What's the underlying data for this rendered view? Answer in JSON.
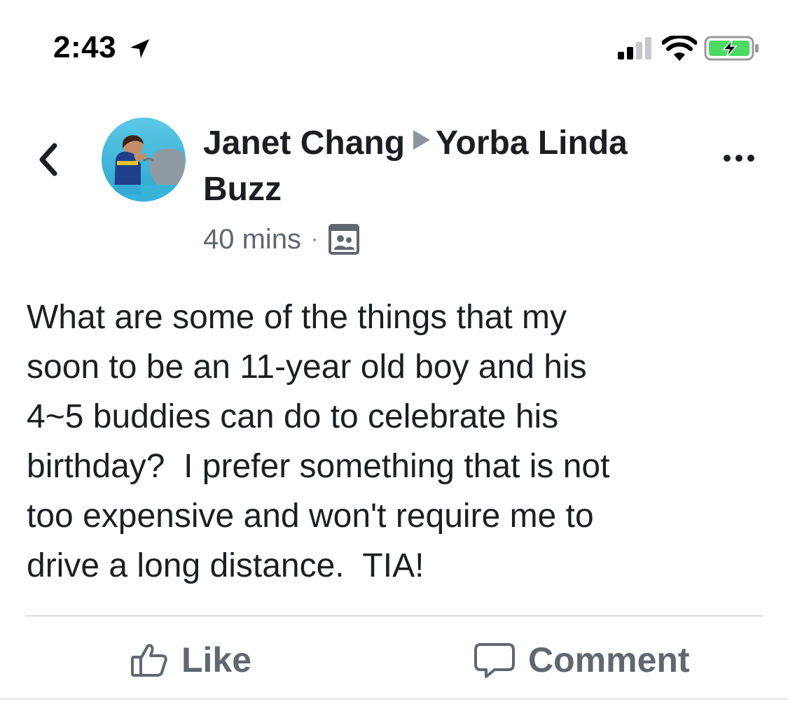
{
  "status_bar": {
    "time": "2:43",
    "location_icon": "location-arrow-icon",
    "signal_icon": "cellular-signal-icon",
    "wifi_icon": "wifi-icon",
    "battery_icon": "battery-charging-icon",
    "battery_color": "#4cd964"
  },
  "header": {
    "back_icon": "chevron-left-icon",
    "author": "Janet Chang",
    "group": "Yorba Linda Buzz",
    "more_icon": "ellipsis-icon",
    "time_ago": "40 mins",
    "separator": "·",
    "audience_icon": "group-members-icon"
  },
  "post": {
    "text": "What are some of the things that my\nsoon to be an 11-year old boy and his\n4~5 buddies can do to celebrate his\nbirthday?  I prefer something that is not\ntoo expensive and won't require me to\ndrive a long distance.  TIA!"
  },
  "actions": {
    "like_label": "Like",
    "like_icon": "thumbs-up-icon",
    "comment_label": "Comment",
    "comment_icon": "speech-bubble-icon"
  },
  "colors": {
    "text": "#1c1e21",
    "secondary_text": "#606770",
    "divider": "#dadde1"
  }
}
